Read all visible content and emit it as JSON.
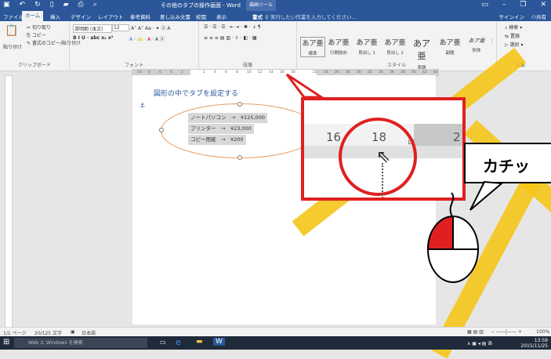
{
  "titlebar": {
    "title": "その他のタブの操作画面 - Word",
    "context_tab": "描画ツール"
  },
  "tabs": [
    "ファイル",
    "ホーム",
    "挿入",
    "デザイン",
    "レイアウト",
    "参考資料",
    "差し込み文書",
    "校閲",
    "表示",
    "書式"
  ],
  "active_tab": "ホーム",
  "tellme": "実行したい作業を入力してください...",
  "signin": "サインイン",
  "share": "共有",
  "clipboard": {
    "paste": "貼り付け",
    "cut": "切り取り",
    "copy": "コピー",
    "format_painter": "書式のコピー/貼り付け",
    "label": "クリップボード"
  },
  "font": {
    "name": "游明朝 (本文(",
    "size": "12",
    "label": "フォント"
  },
  "paragraph": {
    "label": "段落"
  },
  "styles": {
    "label": "スタイル",
    "items": [
      {
        "sample": "あア亜",
        "name": "標準"
      },
      {
        "sample": "あア亜",
        "name": "行間詰め"
      },
      {
        "sample": "あア亜",
        "name": "見出し 1"
      },
      {
        "sample": "あア亜",
        "name": "見出し 2"
      },
      {
        "sample": "あア亜",
        "name": "表題"
      },
      {
        "sample": "あア亜",
        "name": "副題"
      },
      {
        "sample": "あア亜",
        "name": "斜体"
      }
    ]
  },
  "editing": {
    "find": "検索",
    "replace": "置換",
    "select": "選択",
    "label": "編集"
  },
  "ruler": {
    "ticks": [
      "10",
      "8",
      "6",
      "4",
      "2",
      "",
      "2",
      "4",
      "6",
      "8",
      "10",
      "12",
      "14",
      "16",
      "18",
      "",
      "22",
      "24",
      "26",
      "28",
      "30",
      "32",
      "34",
      "36",
      "38",
      "40",
      "42",
      "44"
    ]
  },
  "document": {
    "title": "図形の中でタブを設定する",
    "lines": [
      "ノートパソコン　→　¥125,000",
      "プリンター　→　¥23,000",
      "コピー用紙　→　¥200"
    ]
  },
  "zoom_callout": {
    "num1": "16",
    "num2": "18",
    "num3": "2"
  },
  "speech": "カチッ",
  "status": {
    "page": "1/1 ページ",
    "words": "20/125 文字",
    "lang": "日本語",
    "zoom": "100%"
  },
  "taskbar": {
    "search": "Web と Windows を検索",
    "time": "13:59",
    "date": "2015/11/25"
  },
  "colors": {
    "word_blue": "#2b579a",
    "callout_red": "#e02020",
    "beam_yellow": "#f5c518"
  }
}
